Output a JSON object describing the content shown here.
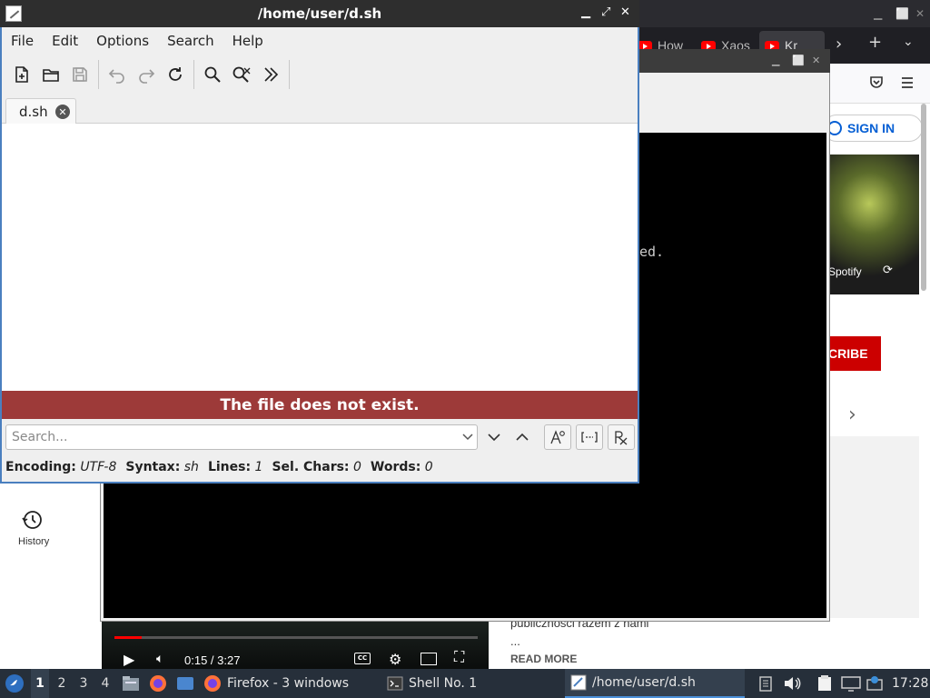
{
  "editor": {
    "title": "/home/user/d.sh",
    "menu": [
      "File",
      "Edit",
      "Options",
      "Search",
      "Help"
    ],
    "tab_label": "d.sh",
    "error_message": "The file does not exist.",
    "search_placeholder": "Search...",
    "status": {
      "encoding_label": "Encoding:",
      "encoding_value": "UTF-8",
      "syntax_label": "Syntax:",
      "syntax_value": "sh",
      "lines_label": "Lines:",
      "lines_value": "1",
      "selchars_label": "Sel. Chars:",
      "selchars_value": "0",
      "words_label": "Words:",
      "words_value": "0"
    }
  },
  "firefox": {
    "tabs": [
      "How",
      "Xaos",
      "Kr"
    ],
    "sign_in": "SIGN IN",
    "subscribe_partial": "CRIBE",
    "spotify_label": "Spotify",
    "history_label": "History",
    "video_time": "0:15 / 3:27",
    "video_progress_fraction": 0.076,
    "desc_text": "publicznosci razem z nami",
    "desc_ellipsis": "...",
    "read_more": "READ MORE"
  },
  "shell": {
    "visible_text": "ed."
  },
  "taskbar": {
    "workspaces": [
      "1",
      "2",
      "3",
      "4"
    ],
    "tasks": {
      "firefox": "Firefox - 3 windows",
      "shell": "Shell No. 1",
      "editor": "/home/user/d.sh"
    },
    "clock": "17:28"
  }
}
